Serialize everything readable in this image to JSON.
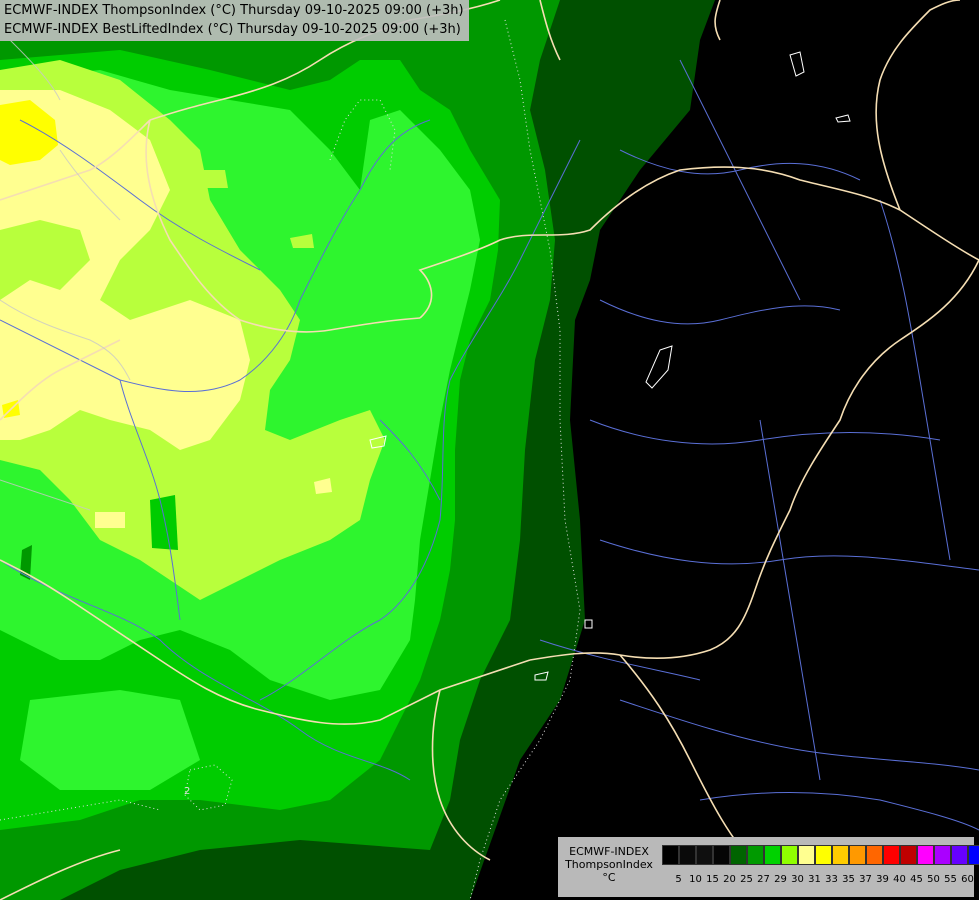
{
  "header": {
    "line1": "ECMWF-INDEX ThompsonIndex (°C) Thursday 09-10-2025 09:00 (+3h)",
    "line2": "ECMWF-INDEX BestLiftedIndex (°C) Thursday 09-10-2025 09:00 (+3h)"
  },
  "legend": {
    "line1": "ECMWF-INDEX",
    "line2": "ThompsonIndex",
    "line3": "°C",
    "ticks": [
      "5",
      "10",
      "15",
      "20",
      "25",
      "27",
      "29",
      "30",
      "31",
      "33",
      "35",
      "37",
      "39",
      "40",
      "45",
      "50",
      "55",
      "60"
    ],
    "colors": [
      "#000000",
      "#0a0a0a",
      "#0f0f0f",
      "#050505",
      "#006400",
      "#009a00",
      "#00d200",
      "#90ff00",
      "#ffff90",
      "#ffff00",
      "#ffcc00",
      "#ff9900",
      "#ff6600",
      "#ff0000",
      "#c00000",
      "#ff00ff",
      "#aa00ff",
      "#6600ff",
      "#0000ff"
    ]
  },
  "map": {
    "contour_label": "2",
    "colors": {
      "background": "#000000",
      "dark_green": "#005000",
      "mid_green": "#00a000",
      "green": "#00d000",
      "bright_green": "#2ef52e",
      "lime": "#b8ff40",
      "pale_yellow": "#ffff90",
      "yellow": "#ffff00",
      "border": "#f5deb3",
      "river": "#5a6fd6"
    }
  }
}
